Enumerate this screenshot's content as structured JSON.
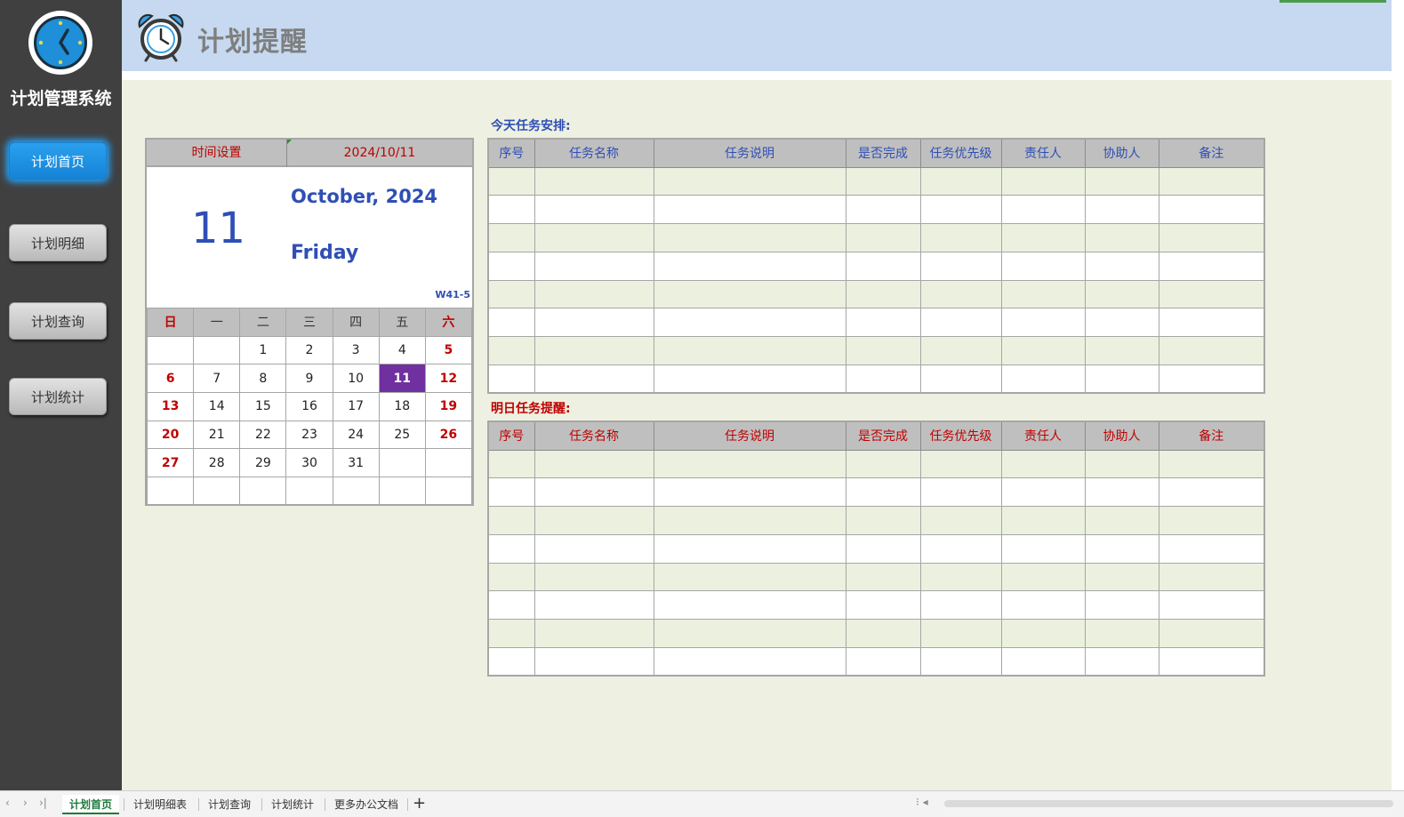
{
  "sidebar": {
    "title": "计划管理系统",
    "items": [
      {
        "label": "计划首页",
        "active": true
      },
      {
        "label": "计划明细",
        "active": false
      },
      {
        "label": "计划查询",
        "active": false
      },
      {
        "label": "计划统计",
        "active": false
      }
    ]
  },
  "header": {
    "title": "计划提醒"
  },
  "date_panel": {
    "setting_label": "时间设置",
    "date_value": "2024/10/11",
    "day": "11",
    "month_year": "October, 2024",
    "weekday": "Friday",
    "week_code": "W41-5",
    "weekday_headers": [
      "日",
      "一",
      "二",
      "三",
      "四",
      "五",
      "六"
    ],
    "weeks": [
      [
        "",
        "",
        "1",
        "2",
        "3",
        "4",
        "5"
      ],
      [
        "6",
        "7",
        "8",
        "9",
        "10",
        "11",
        "12"
      ],
      [
        "13",
        "14",
        "15",
        "16",
        "17",
        "18",
        "19"
      ],
      [
        "20",
        "21",
        "22",
        "23",
        "24",
        "25",
        "26"
      ],
      [
        "27",
        "28",
        "29",
        "30",
        "31",
        "",
        ""
      ],
      [
        "",
        "",
        "",
        "",
        "",
        "",
        ""
      ]
    ],
    "today": "11"
  },
  "today_tasks": {
    "title": "今天任务安排:",
    "columns": [
      "序号",
      "任务名称",
      "任务说明",
      "是否完成",
      "任务优先级",
      "责任人",
      "协助人",
      "备注"
    ],
    "row_count": 8
  },
  "tomorrow_tasks": {
    "title": "明日任务提醒:",
    "columns": [
      "序号",
      "任务名称",
      "任务说明",
      "是否完成",
      "任务优先级",
      "责任人",
      "协助人",
      "备注"
    ],
    "row_count": 8
  },
  "sheet_tabs": {
    "tabs": [
      "计划首页",
      "计划明细表",
      "计划查询",
      "计划统计",
      "更多办公文档"
    ],
    "active": "计划首页",
    "add_symbol": "+"
  },
  "colors": {
    "sidebar_bg": "#404040",
    "accent_blue": "#2f4fb5",
    "accent_red": "#c00000",
    "today_purple": "#7030a0",
    "header_bg": "#c6d9f0"
  }
}
